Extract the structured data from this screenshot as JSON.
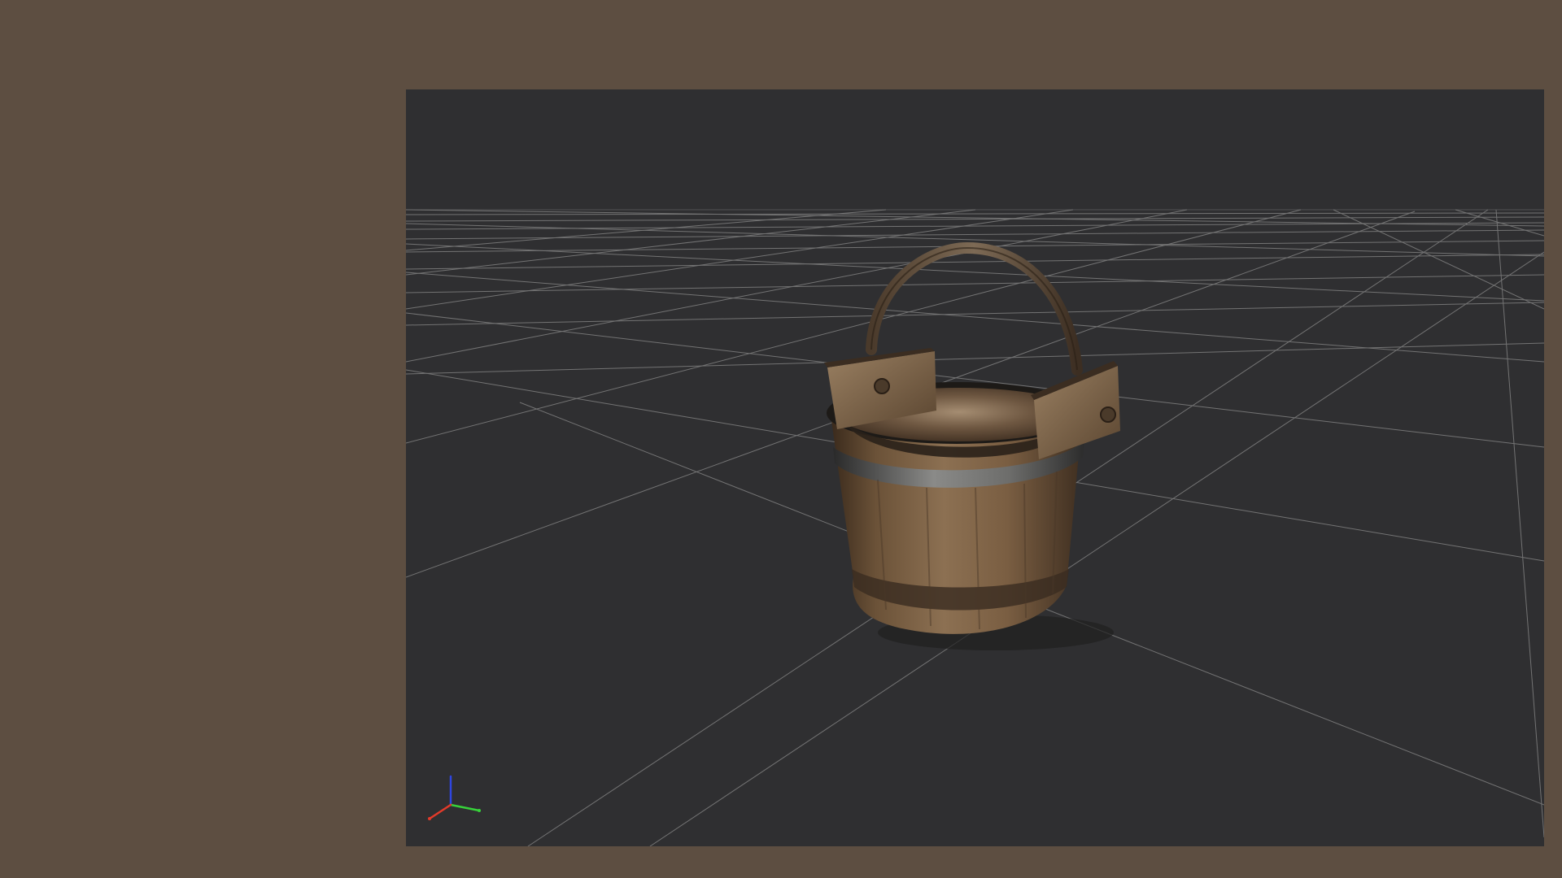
{
  "viewport": {
    "background": "#2f2f31",
    "grid_color": "#8a8a8a",
    "model": "wooden-bucket",
    "axis_gizmo": {
      "x_color": "#e23a2a",
      "y_color": "#37d23a",
      "z_color": "#2f46e0"
    }
  },
  "frame": {
    "background": "#5d4e41"
  }
}
